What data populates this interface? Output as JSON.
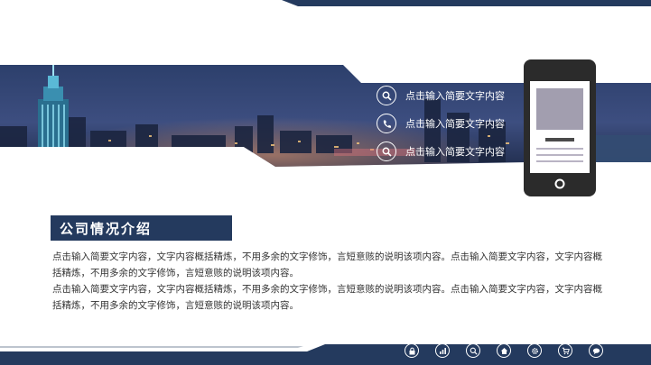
{
  "banner": {
    "links": [
      {
        "icon": "search-icon",
        "label": "点击输入简要文字内容"
      },
      {
        "icon": "phone-icon",
        "label": "点击输入简要文字内容"
      },
      {
        "icon": "search-icon",
        "label": "点击输入简要文字内容"
      }
    ]
  },
  "section": {
    "title": "公司情况介绍",
    "paragraphs": [
      "点击输入简要文字内容，文字内容概括精炼，不用多余的文字修饰，言短意赅的说明该项内容。点击输入简要文字内容，文字内容概括精炼，不用多余的文字修饰，言短意赅的说明该项内容。",
      "点击输入简要文字内容，文字内容概括精炼，不用多余的文字修饰，言短意赅的说明该项内容。点击输入简要文字内容，文字内容概括精炼，不用多余的文字修饰，言短意赅的说明该项内容。"
    ]
  },
  "footer": {
    "icons": [
      "lock-icon",
      "bar-chart-icon",
      "search-icon",
      "home-icon",
      "gear-icon",
      "cart-icon",
      "chat-icon"
    ]
  },
  "colors": {
    "navy": "#243a5e",
    "white": "#ffffff",
    "text": "#333333"
  }
}
